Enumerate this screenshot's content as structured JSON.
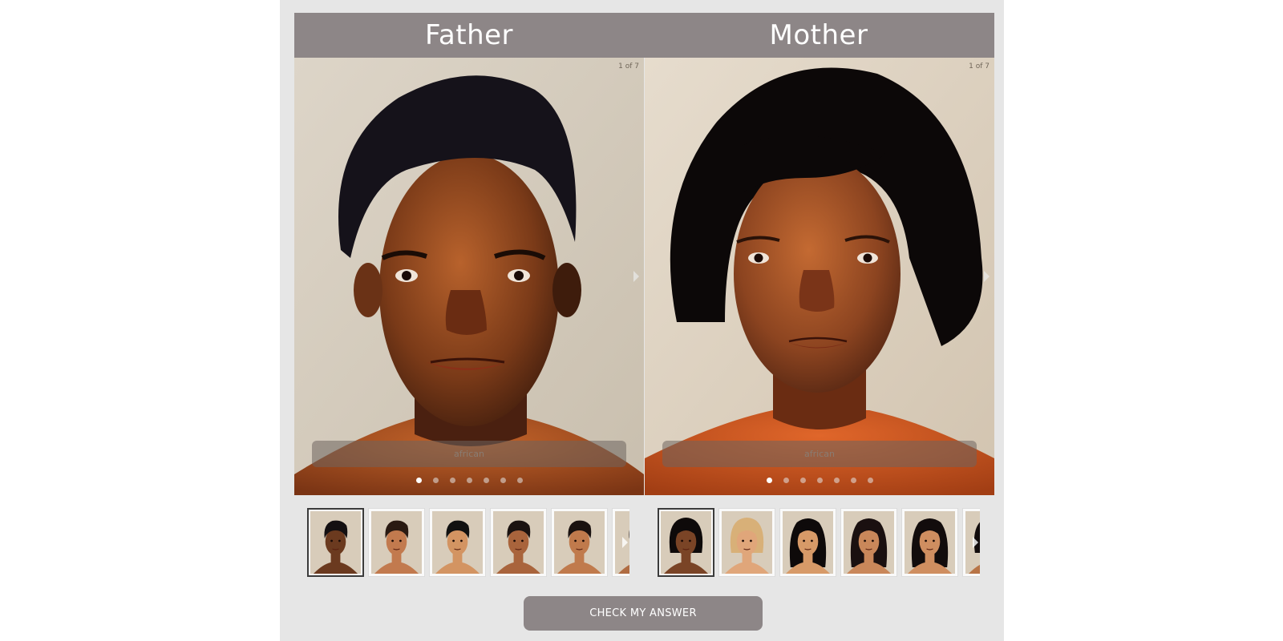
{
  "header": {
    "father_title": "Father",
    "mother_title": "Mother"
  },
  "father_panel": {
    "counter": "1 of 7",
    "caption": "african",
    "dot_count": 7,
    "active_dot": 0
  },
  "mother_panel": {
    "counter": "1 of 7",
    "caption": "african",
    "dot_count": 7,
    "active_dot": 0
  },
  "father_thumbnails": [
    {
      "skin": "#6b3a1f",
      "hair": "#141012",
      "style": "short",
      "selected": true
    },
    {
      "skin": "#c27a4e",
      "hair": "#2a1a12",
      "style": "short",
      "selected": false
    },
    {
      "skin": "#d39462",
      "hair": "#111111",
      "style": "short",
      "selected": false
    },
    {
      "skin": "#a9643c",
      "hair": "#1a1210",
      "style": "short",
      "selected": false
    },
    {
      "skin": "#c07a4c",
      "hair": "#1a1210",
      "style": "short",
      "selected": false
    },
    {
      "skin": "#b06c42",
      "hair": "#1a1210",
      "style": "short",
      "selected": false
    }
  ],
  "mother_thumbnails": [
    {
      "skin": "#7a4426",
      "hair": "#0e0a0a",
      "style": "bob",
      "selected": true
    },
    {
      "skin": "#e0a67a",
      "hair": "#d8b078",
      "style": "bob",
      "selected": false
    },
    {
      "skin": "#d79a68",
      "hair": "#0e0a0a",
      "style": "long",
      "selected": false
    },
    {
      "skin": "#c9875a",
      "hair": "#1a1010",
      "style": "curly",
      "selected": false
    },
    {
      "skin": "#cf8e60",
      "hair": "#120c0c",
      "style": "long",
      "selected": false
    },
    {
      "skin": "#b87446",
      "hair": "#120c0c",
      "style": "bob",
      "selected": false
    }
  ],
  "actions": {
    "check_answer": "CHECK MY ANSWER"
  },
  "colors": {
    "header_bg": "#8d8687",
    "stage_bg": "#e6e6e6",
    "button_bg": "#8d8687"
  }
}
